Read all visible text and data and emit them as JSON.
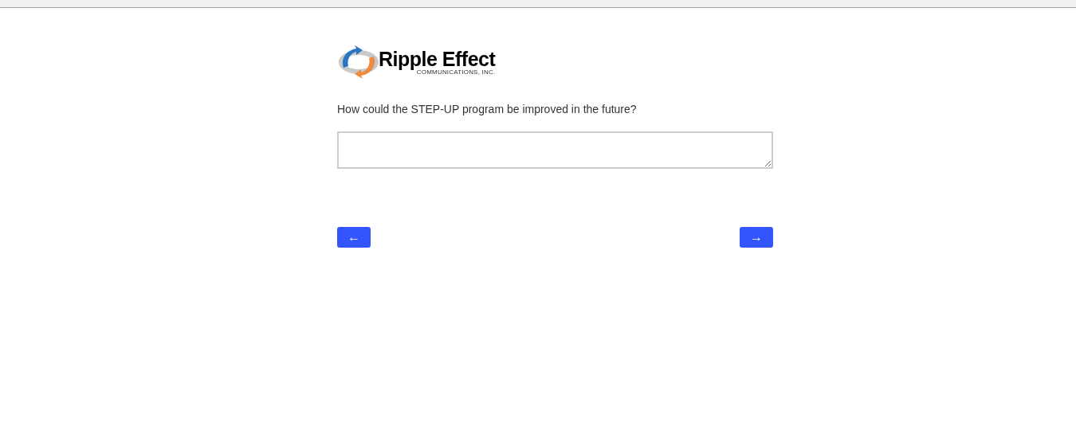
{
  "logo": {
    "name": "Ripple Effect",
    "subtitle": "COMMUNICATIONS, INC."
  },
  "question": {
    "text": "How could the STEP-UP program be improved in the future?"
  },
  "buttons": [
    {
      "kind": "back",
      "label": "←"
    },
    {
      "kind": "next",
      "label": "→"
    }
  ]
}
